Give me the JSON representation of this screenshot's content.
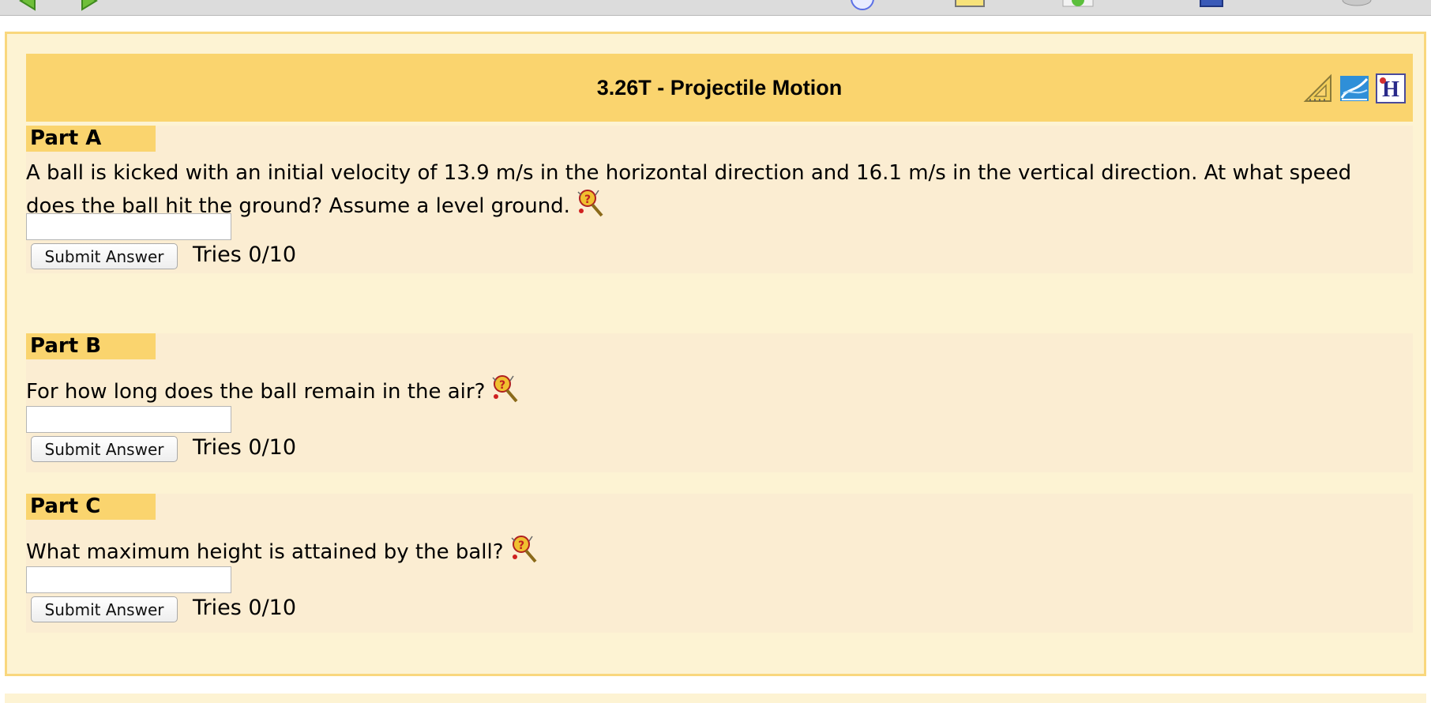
{
  "header": {
    "title": "3.26T - Projectile Motion"
  },
  "parts": [
    {
      "label": "Part A",
      "question": "A ball is kicked with an initial velocity of 13.9 m/s in the horizontal direction and 16.1 m/s in the vertical direction. At what speed does the ball hit the ground? Assume a level ground.",
      "answer_value": "",
      "submit_label": "Submit Answer",
      "tries": "Tries 0/10"
    },
    {
      "label": "Part B",
      "question": "For how long does the ball remain in the air?",
      "answer_value": "",
      "submit_label": "Submit Answer",
      "tries": "Tries 0/10"
    },
    {
      "label": "Part C",
      "question": "What maximum height is attained by the ball?",
      "answer_value": "",
      "submit_label": "Submit Answer",
      "tries": "Tries 0/10"
    }
  ],
  "icons": {
    "toolbar": [
      "back-arrow-icon",
      "forward-arrow-icon",
      "clock-icon",
      "notepad-icon",
      "refresh-icon",
      "calculator-icon",
      "printer-icon"
    ],
    "header": [
      "ruler-icon",
      "graph-icon",
      "help-icon"
    ],
    "hint": "hint-icon"
  },
  "colors": {
    "header_bg": "#fad46e",
    "container_bg": "#fdf3d3",
    "part_bg": "#fbedd2",
    "border": "#f9d77d"
  }
}
